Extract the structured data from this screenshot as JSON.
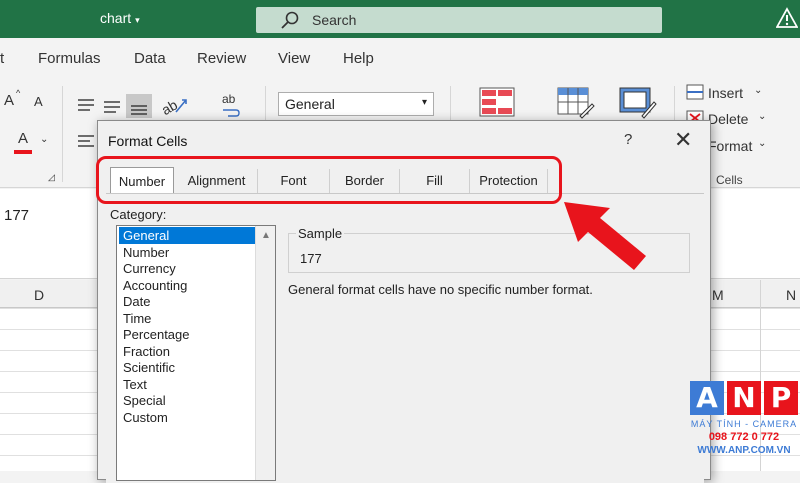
{
  "titlebar": {
    "doc_title": "chart",
    "caret": "▾",
    "search_placeholder": "Search"
  },
  "menu": [
    "t",
    "Formulas",
    "Data",
    "Review",
    "View",
    "Help"
  ],
  "ribbon": {
    "font_grow": "A",
    "font_shrink": "A",
    "font_color": "A",
    "wrap_label": "ab",
    "number_format": "General",
    "insert": "Insert",
    "delete": "Delete",
    "format": "Format",
    "cells_group": "Cells",
    "dropdown_caret": "⌄"
  },
  "formula_bar": {
    "value": "177"
  },
  "columns": {
    "d": "D",
    "m": "M",
    "n": "N"
  },
  "dialog": {
    "title": "Format Cells",
    "help": "?",
    "close": "✕",
    "tabs": [
      "Number",
      "Alignment",
      "Font",
      "Border",
      "Fill",
      "Protection"
    ],
    "category_label": "Category:",
    "categories": [
      "General",
      "Number",
      "Currency",
      "Accounting",
      "Date",
      "Time",
      "Percentage",
      "Fraction",
      "Scientific",
      "Text",
      "Special",
      "Custom"
    ],
    "selected_category": "General",
    "sample_label": "Sample",
    "sample_value": "177",
    "description": "General format cells have no specific number format."
  },
  "watermark": {
    "letters": [
      "A",
      "N",
      "P"
    ],
    "sub": "MÁY TÍNH - CAMERA",
    "phone": "098 772 0 772",
    "web": "WWW.ANP.COM.VN"
  },
  "colors": {
    "excel_green": "#217346",
    "highlight_red": "#e8141c",
    "selection_blue": "#0078d7"
  }
}
